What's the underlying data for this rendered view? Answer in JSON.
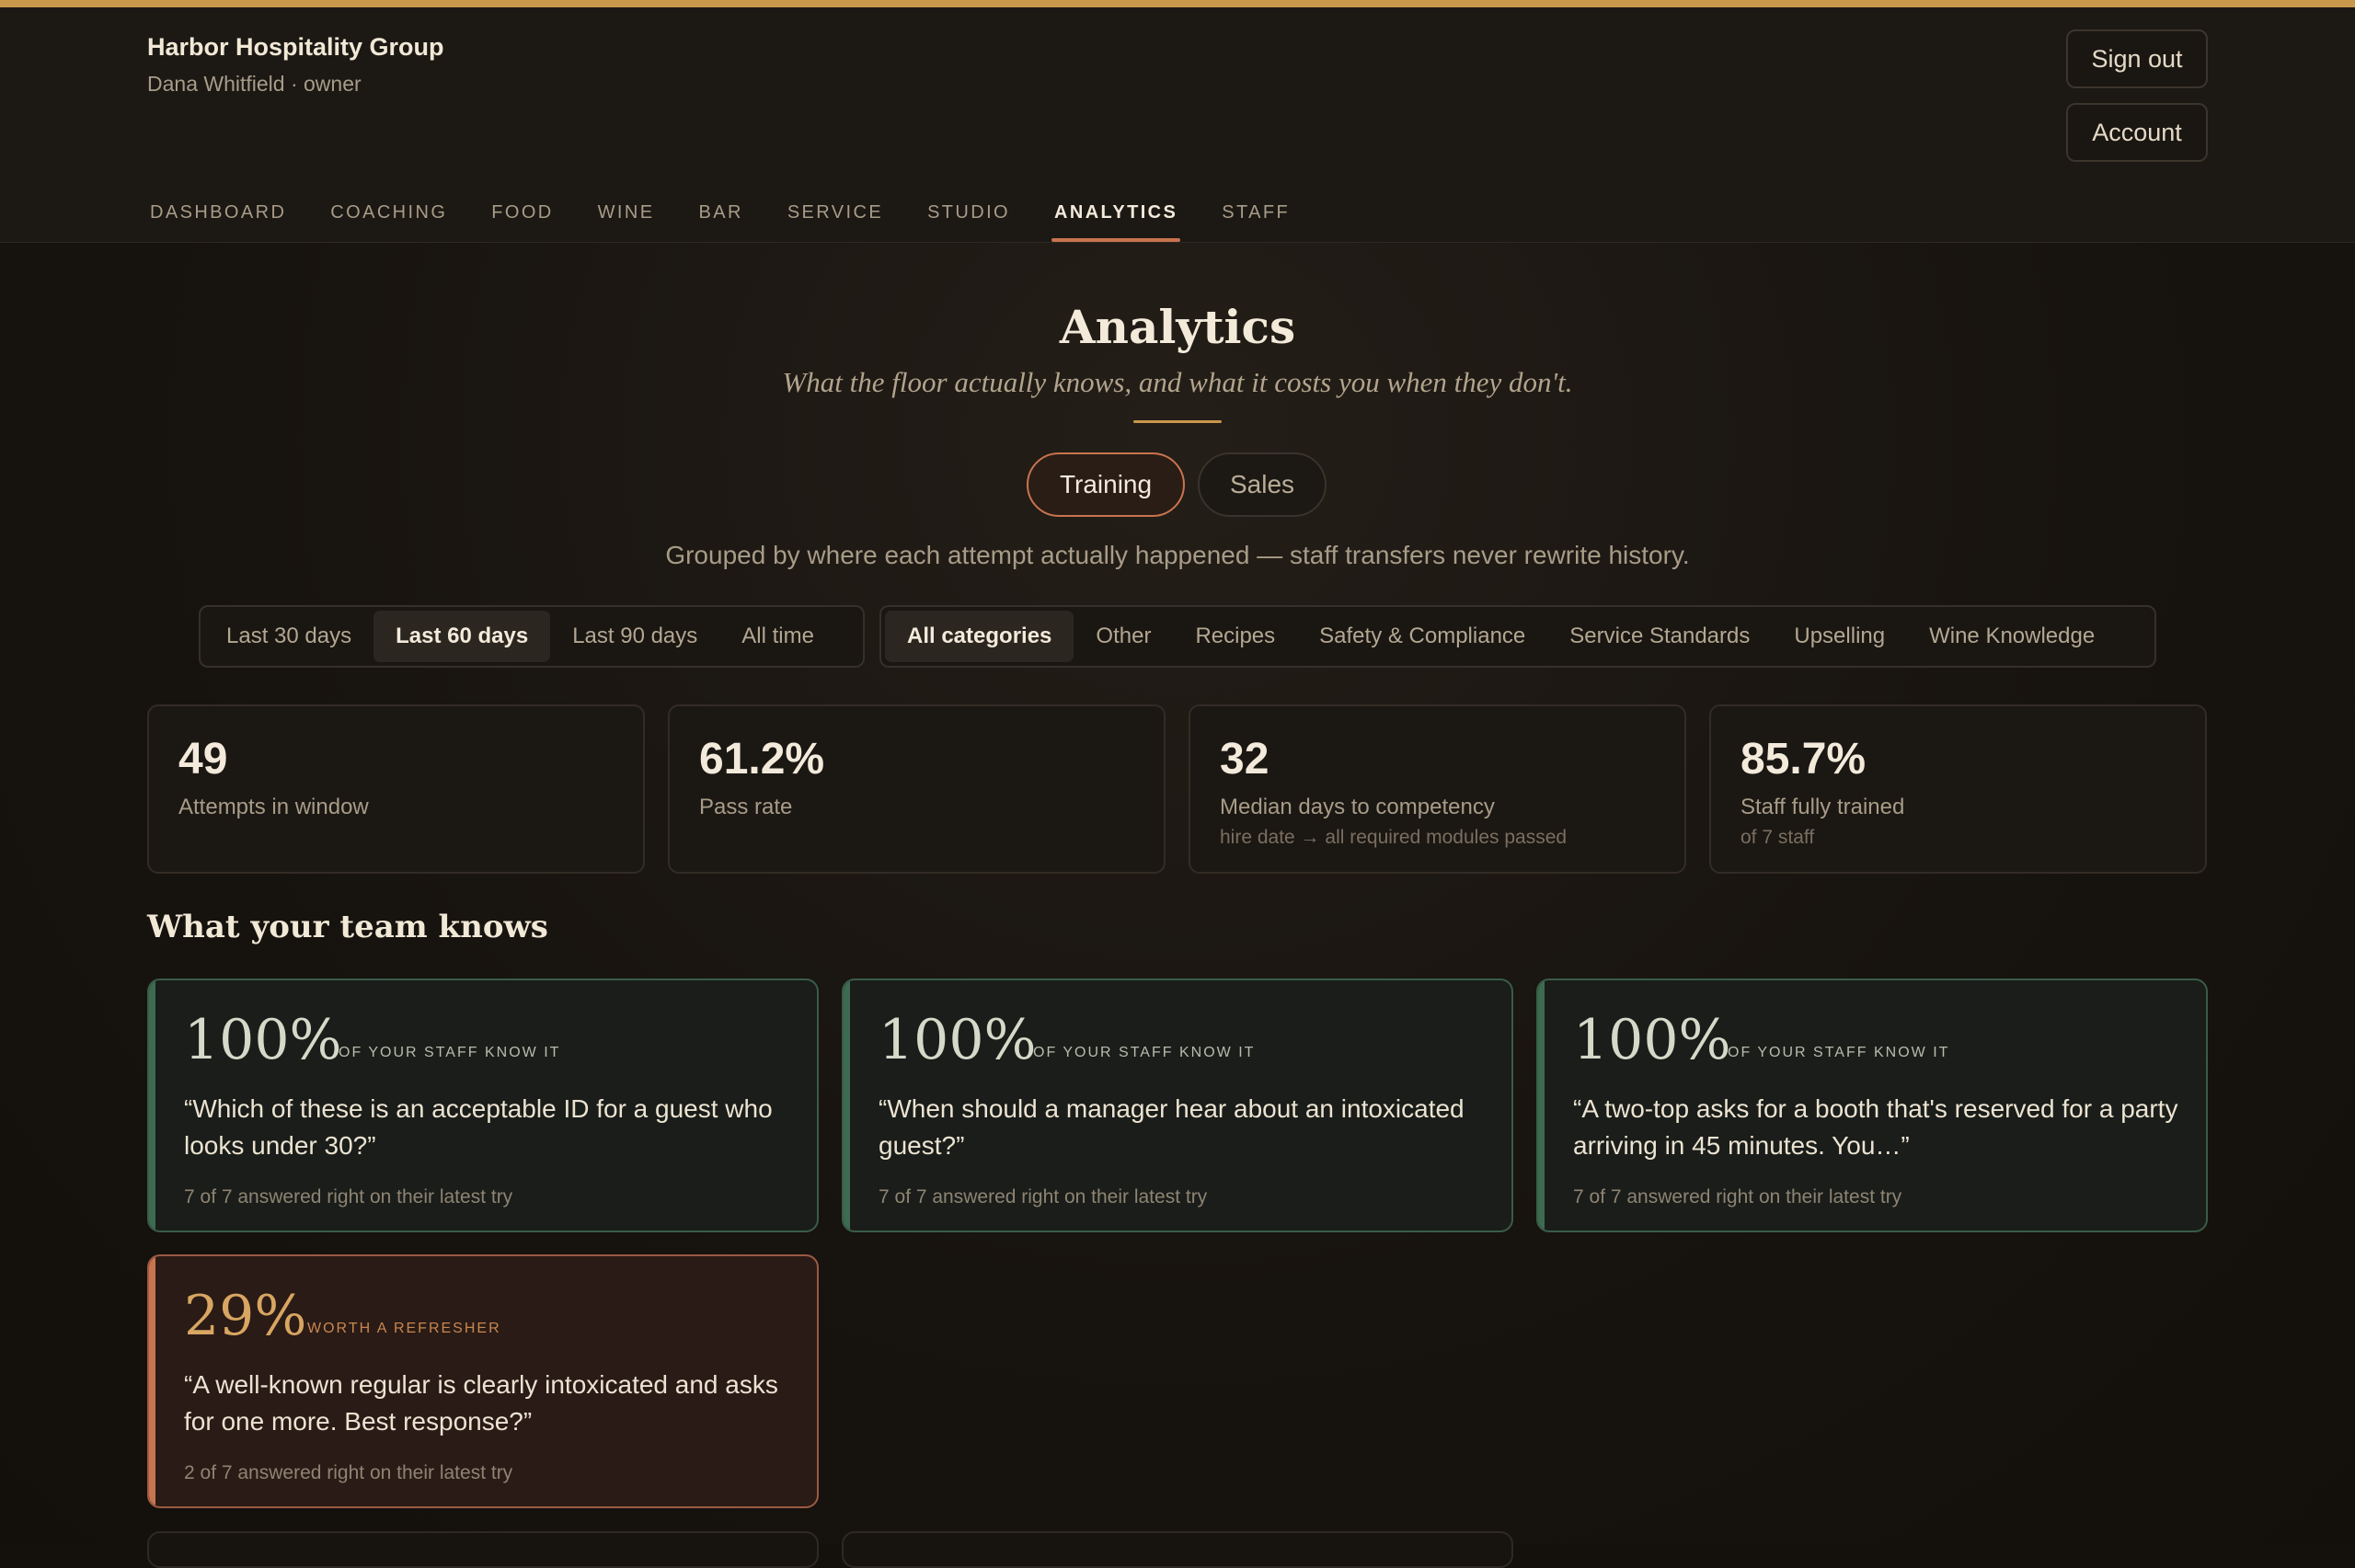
{
  "header": {
    "org_name": "Harbor Hospitality Group",
    "user_line": "Dana Whitfield · owner",
    "sign_out": "Sign out",
    "account": "Account"
  },
  "nav": {
    "items": [
      "DASHBOARD",
      "COACHING",
      "FOOD",
      "WINE",
      "BAR",
      "SERVICE",
      "STUDIO",
      "ANALYTICS",
      "STAFF"
    ],
    "active": "ANALYTICS"
  },
  "page": {
    "title": "Analytics",
    "subtitle": "What the floor actually knows, and what it costs you when they don't.",
    "toggle": {
      "training": "Training",
      "sales": "Sales",
      "active": "Training"
    },
    "note": "Grouped by where each attempt actually happened — staff transfers never rewrite history."
  },
  "filters": {
    "ranges": [
      "Last 30 days",
      "Last 60 days",
      "Last 90 days",
      "All time"
    ],
    "active_range": "Last 60 days",
    "categories": [
      "All categories",
      "Other",
      "Recipes",
      "Safety & Compliance",
      "Service Standards",
      "Upselling",
      "Wine Knowledge"
    ],
    "active_category": "All categories"
  },
  "stats": [
    {
      "value": "49",
      "label": "Attempts in window",
      "sub": ""
    },
    {
      "value": "61.2%",
      "label": "Pass rate",
      "sub": ""
    },
    {
      "value": "32",
      "label": "Median days to competency",
      "sub": "hire date → all required modules passed"
    },
    {
      "value": "85.7%",
      "label": "Staff fully trained",
      "sub": "of 7 staff"
    }
  ],
  "knowledge": {
    "section_title": "What your team knows",
    "cards": [
      {
        "pct": "100%",
        "tag": "OF YOUR STAFF KNOW IT",
        "question": "“Which of these is an acceptable ID for a guest who looks under 30?”",
        "meta": "7 of 7 answered right on their latest try",
        "status": "good"
      },
      {
        "pct": "100%",
        "tag": "OF YOUR STAFF KNOW IT",
        "question": "“When should a manager hear about an intoxicated guest?”",
        "meta": "7 of 7 answered right on their latest try",
        "status": "good"
      },
      {
        "pct": "100%",
        "tag": "OF YOUR STAFF KNOW IT",
        "question": "“A two-top asks for a booth that's reserved for a party arriving in 45 minutes. You…”",
        "meta": "7 of 7 answered right on their latest try",
        "status": "good"
      },
      {
        "pct": "29%",
        "tag": "WORTH A REFRESHER",
        "question": "“A well-known regular is clearly intoxicated and asks for one more. Best response?”",
        "meta": "2 of 7 answered right on their latest try",
        "status": "warn"
      }
    ]
  },
  "colors": {
    "accent_gold": "#c9974b",
    "accent_copper": "#c8744e",
    "good_border": "#3a5c48",
    "warn_border": "#9b5a42",
    "background": "#14110d"
  }
}
